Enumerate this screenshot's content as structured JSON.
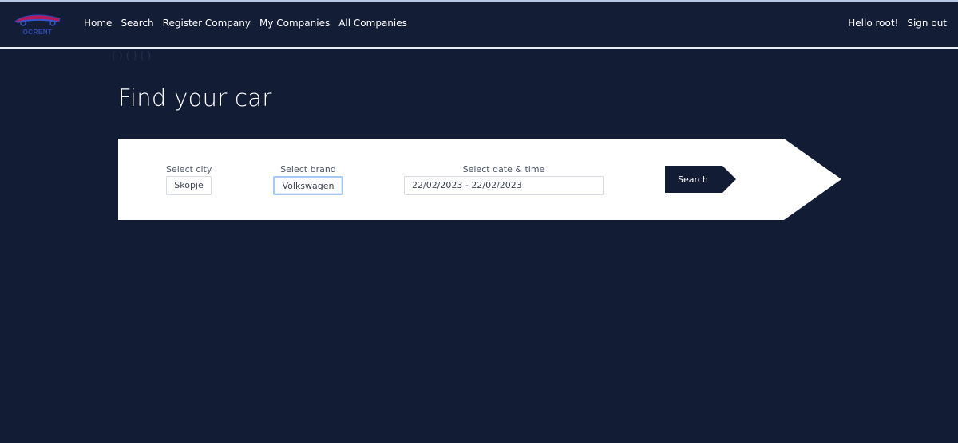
{
  "header": {
    "logo_text": "OCRENT",
    "nav": [
      {
        "label": "Home"
      },
      {
        "label": "Search"
      },
      {
        "label": "Register Company"
      },
      {
        "label": "My Companies"
      },
      {
        "label": "All Companies"
      }
    ],
    "greeting": "Hello root!",
    "signout": "Sign out"
  },
  "faint_text": "( ) ( ) ( )",
  "main": {
    "title": "Find your car",
    "city": {
      "label": "Select city",
      "value": "Skopje"
    },
    "brand": {
      "label": "Select brand",
      "value": "Volkswagen"
    },
    "date": {
      "label": "Select date & time",
      "value": "22/02/2023 - 22/02/2023"
    },
    "search_button": "Search"
  },
  "colors": {
    "background": "#131c35",
    "panel": "#ffffff",
    "button": "#131c35",
    "logo_accent": "#b3195c"
  }
}
